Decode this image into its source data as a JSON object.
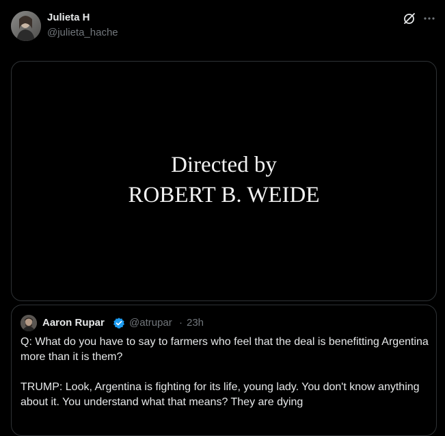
{
  "tweet": {
    "author": {
      "name": "Julieta H",
      "handle": "@julieta_hache",
      "avatar_icon": "profile-photo"
    },
    "actions": {
      "grok_icon": "grok-icon",
      "more_icon": "more-icon"
    },
    "media": {
      "line1": "Directed by",
      "line2": "ROBERT B. WEIDE"
    }
  },
  "quoted": {
    "author": {
      "name": "Aaron Rupar",
      "handle": "@atrupar",
      "separator": "·",
      "time": "23h",
      "verified": true,
      "verified_color": "#1d9bf0"
    },
    "text_paragraph_1": "Q: What do you have to say to farmers who feel that the deal is benefitting Argentina more than it is them?",
    "text_paragraph_2": "TRUMP: Look, Argentina is fighting for its life, young lady. You don't know anything about it. You understand what that means? They are dying"
  },
  "colors": {
    "background": "#000000",
    "primary_text": "#e7e9ea",
    "secondary_text": "#71767b",
    "border": "#2f3336"
  }
}
